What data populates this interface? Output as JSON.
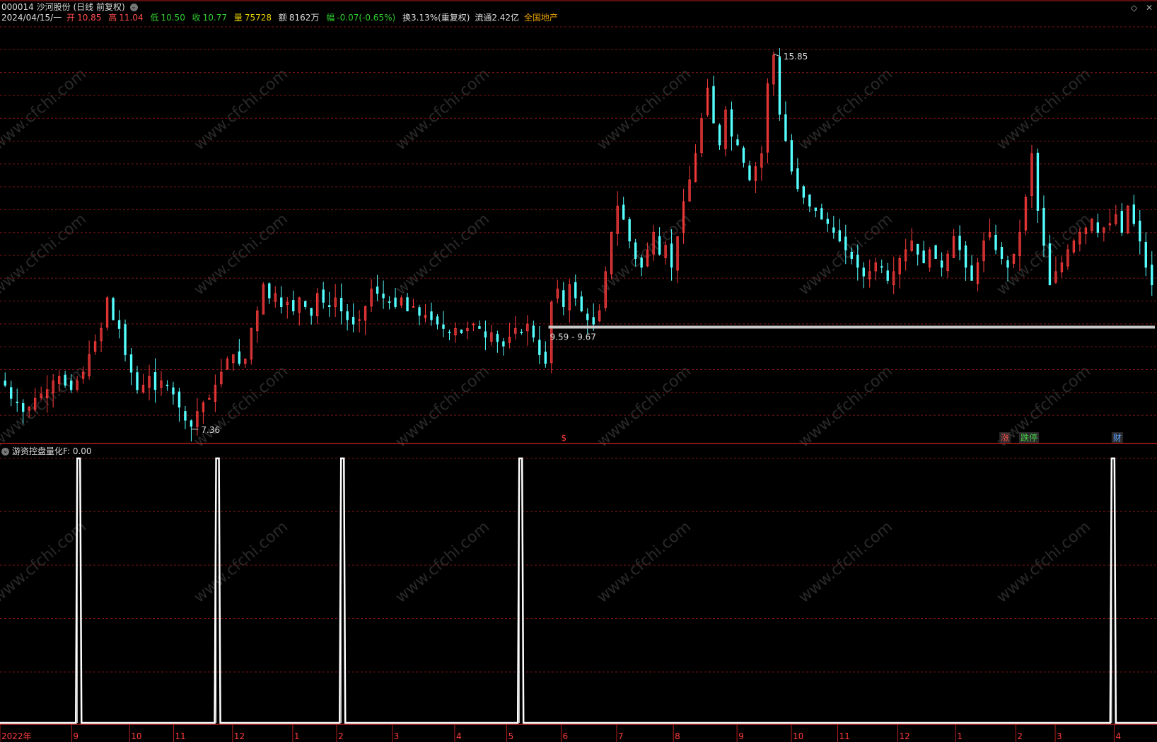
{
  "header": {
    "code": "000014",
    "name": "沙河股份",
    "mode": "(日线 前复权)",
    "date": "2024/04/15/一",
    "open_label": "开",
    "open": "10.85",
    "high_label": "高",
    "high": "11.04",
    "low_label": "低",
    "low": "10.50",
    "close_label": "收",
    "close": "10.77",
    "vol_label": "量",
    "vol": "75728",
    "amt_label": "额",
    "amt": "8162万",
    "chg_label": "幅",
    "chg": "-0.07(-0.65%)",
    "turnover": "换3.13%(重复权)",
    "float": "流通2.42亿",
    "sector": "全国地产"
  },
  "indicator": {
    "name": "游资控盘量化F",
    "value": ": 0.00"
  },
  "watermark": "www.cfchi.com",
  "colors": {
    "up": "#ff3c3c",
    "down": "#54ffff",
    "grid": "#7a1414",
    "axis": "#b41e1e",
    "text": "#dddddd",
    "support": "#c8c8c8",
    "signal": "#ffffff"
  },
  "chart_data": [
    {
      "type": "candlestick",
      "annotations": [
        {
          "text": "15.85",
          "kind": "max"
        },
        {
          "text": "7.36",
          "kind": "min"
        },
        {
          "text": "9.59 - 9.67",
          "kind": "support-band",
          "low": 9.59,
          "high": 9.67
        }
      ],
      "event_markers": [
        "$",
        "涨",
        "跌停",
        "财"
      ],
      "y_range": [
        7.0,
        16.5
      ],
      "key_values": {
        "max": 15.85,
        "min": 7.36,
        "last_close": 10.77
      },
      "note": "approximate daily price path, 2022-08 to 2024-04",
      "closes": [
        8.3,
        8.0,
        7.9,
        7.7,
        7.8,
        8.0,
        8.1,
        8.2,
        8.4,
        8.5,
        8.3,
        8.2,
        8.4,
        8.6,
        9.0,
        9.3,
        9.6,
        10.3,
        9.8,
        9.6,
        9.0,
        8.6,
        8.2,
        8.3,
        8.5,
        8.2,
        8.4,
        8.3,
        8.1,
        7.8,
        7.5,
        7.36,
        7.7,
        7.9,
        8.0,
        8.3,
        8.6,
        8.9,
        9.0,
        8.8,
        8.9,
        9.6,
        10.0,
        10.6,
        10.3,
        10.4,
        10.1,
        10.2,
        10.0,
        10.3,
        10.1,
        9.9,
        10.4,
        10.2,
        10.1,
        10.3,
        10.0,
        9.8,
        9.7,
        9.8,
        10.1,
        10.5,
        10.4,
        10.3,
        10.2,
        10.1,
        10.3,
        10.0,
        10.1,
        9.9,
        9.9,
        9.8,
        9.7,
        9.6,
        9.5,
        9.6,
        9.5,
        9.6,
        9.7,
        9.6,
        9.4,
        9.5,
        9.3,
        9.2,
        9.4,
        9.6,
        9.5,
        9.7,
        9.4,
        9.0,
        8.8,
        10.2,
        10.5,
        10.1,
        10.6,
        10.3,
        10.0,
        9.8,
        9.7,
        10.0,
        10.9,
        11.8,
        12.4,
        12.1,
        11.6,
        11.2,
        11.0,
        11.4,
        11.8,
        11.3,
        11.5,
        11.0,
        11.7,
        12.5,
        13.0,
        13.6,
        14.4,
        15.1,
        14.3,
        13.8,
        14.6,
        14.0,
        13.8,
        13.4,
        13.0,
        13.3,
        13.6,
        15.2,
        15.85,
        14.5,
        13.9,
        13.2,
        12.8,
        12.6,
        12.4,
        12.3,
        12.1,
        12.0,
        11.8,
        11.6,
        11.4,
        11.2,
        11.0,
        10.8,
        10.9,
        11.1,
        11.0,
        10.7,
        10.9,
        11.2,
        11.4,
        11.6,
        11.3,
        11.1,
        11.4,
        11.2,
        11.0,
        11.3,
        11.7,
        11.4,
        11.0,
        10.7,
        11.1,
        11.6,
        11.8,
        11.4,
        11.2,
        11.0,
        11.3,
        11.8,
        12.6,
        13.6,
        12.3,
        11.5,
        10.6,
        10.9,
        11.1,
        11.4,
        11.6,
        11.8,
        11.9,
        12.1,
        11.8,
        11.9,
        12.0,
        12.2,
        11.8,
        12.4,
        12.0,
        11.6,
        11.0,
        10.6
      ]
    },
    {
      "type": "line",
      "name": "游资控盘量化F",
      "current_value": 0.0,
      "signal_positions": [
        0.068,
        0.188,
        0.296,
        0.45,
        0.962
      ],
      "y_range": [
        0,
        1
      ]
    }
  ],
  "x_axis": {
    "labels": [
      {
        "text": "2022年",
        "pos": 0.0
      },
      {
        "text": "9",
        "pos": 0.062
      },
      {
        "text": "10",
        "pos": 0.112
      },
      {
        "text": "11",
        "pos": 0.15
      },
      {
        "text": "12",
        "pos": 0.201
      },
      {
        "text": "1",
        "pos": 0.253
      },
      {
        "text": "2",
        "pos": 0.291
      },
      {
        "text": "3",
        "pos": 0.339
      },
      {
        "text": "4",
        "pos": 0.393
      },
      {
        "text": "5",
        "pos": 0.438
      },
      {
        "text": "6",
        "pos": 0.485
      },
      {
        "text": "7",
        "pos": 0.533
      },
      {
        "text": "8",
        "pos": 0.582
      },
      {
        "text": "9",
        "pos": 0.637
      },
      {
        "text": "10",
        "pos": 0.684
      },
      {
        "text": "11",
        "pos": 0.724
      },
      {
        "text": "12",
        "pos": 0.776
      },
      {
        "text": "1",
        "pos": 0.826
      },
      {
        "text": "2",
        "pos": 0.878
      },
      {
        "text": "3",
        "pos": 0.912
      },
      {
        "text": "4",
        "pos": 0.963
      }
    ]
  }
}
